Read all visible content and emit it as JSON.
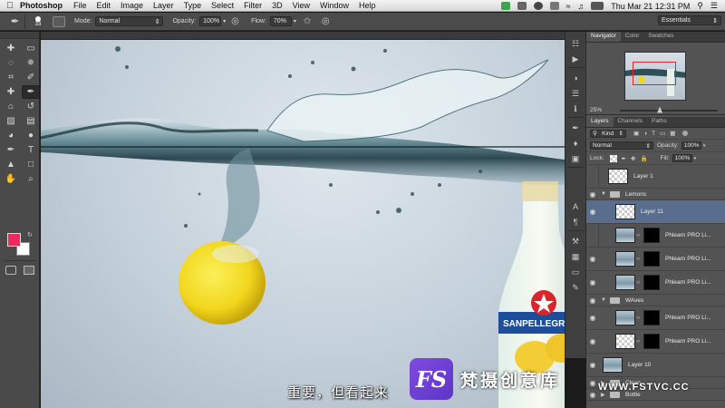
{
  "menubar": {
    "app_name": "Photoshop",
    "items": [
      "File",
      "Edit",
      "Image",
      "Layer",
      "Type",
      "Select",
      "Filter",
      "3D",
      "View",
      "Window",
      "Help"
    ],
    "clock": "Thu Mar 21  12:31 PM"
  },
  "options": {
    "brush_size": "33",
    "mode_label": "Mode:",
    "mode_value": "Normal",
    "opacity_label": "Opacity:",
    "opacity_value": "100%",
    "flow_label": "Flow:",
    "flow_value": "70%",
    "workspace": "Essentials"
  },
  "colors": {
    "foreground": "#ec2a5c",
    "background": "#ffffff",
    "selection": "#596e8f"
  },
  "tools": [
    "move-icon",
    "marquee-icon",
    "lasso-icon",
    "quick-select-icon",
    "crop-icon",
    "eyedropper-icon",
    "healing-icon",
    "brush-icon",
    "clone-stamp-icon",
    "history-brush-icon",
    "eraser-icon",
    "gradient-icon",
    "blur-icon",
    "dodge-icon",
    "pen-icon",
    "type-icon",
    "path-select-icon",
    "shape-icon",
    "hand-icon",
    "zoom-icon"
  ],
  "navigator": {
    "tabs": [
      "Navigator",
      "Color",
      "Swatches"
    ],
    "zoom": "25%"
  },
  "layers_panel": {
    "tabs": [
      "Layers",
      "Channels",
      "Paths"
    ],
    "filter": "Kind",
    "blend": "Normal",
    "opacity_label": "Opacity:",
    "opacity": "100%",
    "lock_label": "Lock:",
    "fill_label": "Fill:",
    "fill": "100%",
    "layers": [
      {
        "name": "Layer 1"
      },
      {
        "name": "Lemons"
      },
      {
        "name": "Layer 11"
      },
      {
        "name": "Phlearn PRO Li..."
      },
      {
        "name": "Phlearn PRO Li..."
      },
      {
        "name": "Phlearn PRO Li..."
      },
      {
        "name": "WAves"
      },
      {
        "name": "Phlearn PRO Li..."
      },
      {
        "name": "Phlearn PRO Li..."
      },
      {
        "name": "Layer 10"
      },
      {
        "name": "Clean"
      },
      {
        "name": "Bottle"
      }
    ]
  },
  "subtitle": "重要，但看起来",
  "watermark": {
    "logo": "FS",
    "text": "梵摄创意库",
    "url": "WWW.FSTVC.CC"
  },
  "bottle_label": "SANPELLEGRINO"
}
